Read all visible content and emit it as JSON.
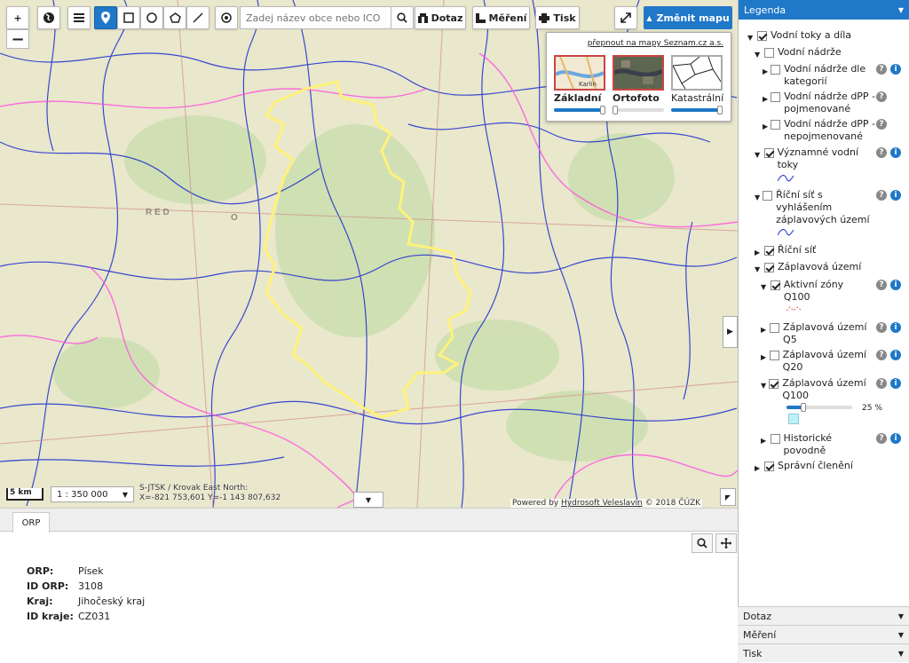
{
  "toolbar": {
    "search_placeholder": "Zadej název obce nebo ICO",
    "query_label": "Dotaz",
    "measure_label": "Měření",
    "print_label": "Tisk",
    "change_map_label": "Změnit mapu",
    "zoom_in": "+",
    "zoom_out": "−"
  },
  "map_switcher": {
    "link": "přepnout na mapy Seznam.cz a.s.",
    "options": [
      {
        "label": "Základní",
        "opacity": 0.95
      },
      {
        "label": "Ortofoto",
        "opacity": 0.05
      },
      {
        "label": "Katastrální",
        "opacity": 1.0
      }
    ],
    "thumb_text": "Karlín"
  },
  "map": {
    "scale_km": "5 km",
    "scale_ratio": "1 : 350 000",
    "coords_line1": "S-JTSK / Krovak East North:",
    "coords_line2": "X=-821 753,601 Y=-1 143 807,632",
    "powered_by": "Powered by",
    "powered_link": "Hydrosoft Veleslavín",
    "copyright": "© 2018 ČÚZK"
  },
  "bottom": {
    "tab": "ORP",
    "attributes": [
      {
        "key": "ORP:",
        "value": "Písek"
      },
      {
        "key": "ID ORP:",
        "value": "3108"
      },
      {
        "key": "Kraj:",
        "value": "Jihočeský kraj"
      },
      {
        "key": "ID kraje:",
        "value": "CZ031"
      }
    ]
  },
  "legend": {
    "title": "Legenda",
    "items": [
      {
        "label": "Vodní toky a díla"
      },
      {
        "label": "Vodní nádrže"
      },
      {
        "label": "Vodní nádrže dle kategorií"
      },
      {
        "label": "Vodní nádrže dPP - pojmenované"
      },
      {
        "label": "Vodní nádrže dPP - nepojmenované"
      },
      {
        "label": "Významné vodní toky"
      },
      {
        "label": "Říční síť s vyhlášením záplavových území"
      },
      {
        "label": "Říční síť"
      },
      {
        "label": "Záplavová území"
      },
      {
        "label": "Aktivní zóny Q100"
      },
      {
        "label": "Záplavová území Q5"
      },
      {
        "label": "Záplavová území Q20"
      },
      {
        "label": "Záplavová území Q100"
      },
      {
        "label": "Historické povodně"
      },
      {
        "label": "Správní členění"
      }
    ],
    "opacity_label": "25 %",
    "opacity_value": 0.25,
    "accordion": [
      {
        "label": "Dotaz"
      },
      {
        "label": "Měření"
      },
      {
        "label": "Tisk"
      }
    ]
  },
  "colors": {
    "accent": "#1f78c8",
    "rivers": "#1a2ccf",
    "border": "#ff66ff",
    "region": "#fff27a"
  }
}
